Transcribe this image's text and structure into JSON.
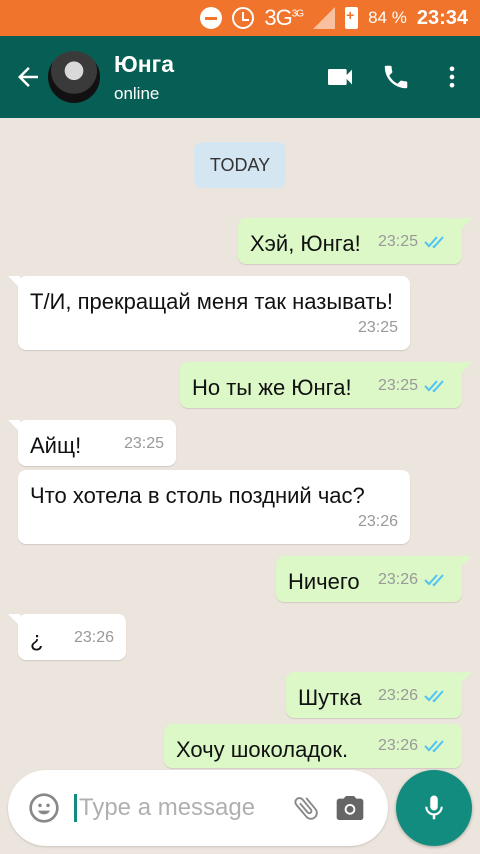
{
  "status_bar": {
    "network": "3G",
    "network_small": "3G",
    "battery_percent": "84 %",
    "time": "23:34"
  },
  "header": {
    "contact_name": "Юнга",
    "contact_status": "online",
    "icons": [
      "back-arrow-icon",
      "avatar",
      "video-call-icon",
      "phone-icon",
      "more-vert-icon"
    ]
  },
  "chat": {
    "date_label": "TODAY",
    "messages": [
      {
        "dir": "out",
        "text": "Хэй, Юнга!",
        "time": "23:25",
        "read": true
      },
      {
        "dir": "in",
        "text": "Т/И, прекращай меня так называть!",
        "time": "23:25"
      },
      {
        "dir": "out",
        "text": "Но ты же Юнга!",
        "time": "23:25",
        "read": true
      },
      {
        "dir": "in",
        "text": "Айщ!",
        "time": "23:25"
      },
      {
        "dir": "in",
        "text": "Что хотела в столь поздний час?",
        "time": "23:26"
      },
      {
        "dir": "out",
        "text": "Ничего",
        "time": "23:26",
        "read": true
      },
      {
        "dir": "in",
        "text": "¿",
        "time": "23:26"
      },
      {
        "dir": "out",
        "text": "Шутка",
        "time": "23:26",
        "read": true
      },
      {
        "dir": "out",
        "text": "Хочу шоколадок.",
        "time": "23:26",
        "read": true
      }
    ]
  },
  "input": {
    "placeholder": "Type a message",
    "value": ""
  },
  "colors": {
    "status_bar": "#f0742b",
    "header": "#075e54",
    "accent": "#128c7e",
    "outgoing_bubble": "#dcf8c6",
    "incoming_bubble": "#ffffff",
    "read_ticks": "#4fc3f7",
    "chat_background": "#ece5dd"
  }
}
